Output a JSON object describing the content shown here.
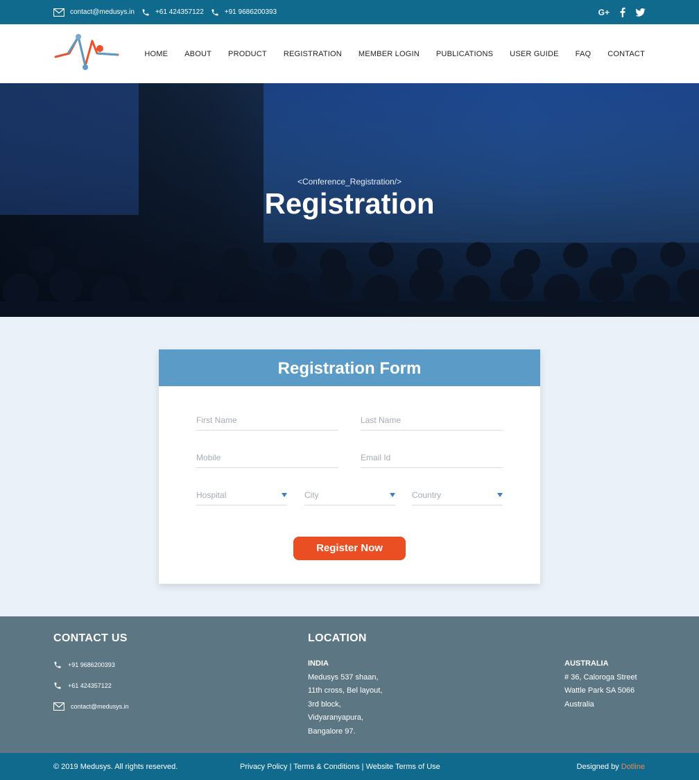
{
  "topbar": {
    "email": "contact@medusys.in",
    "phone1": "+61 424357122",
    "phone2": "+91 9686200393",
    "social": [
      "google-plus",
      "facebook",
      "twitter"
    ],
    "gplus_label": "G+"
  },
  "nav": {
    "items": [
      "HOME",
      "ABOUT",
      "PRODUCT",
      "REGISTRATION",
      "MEMBER LOGIN",
      "PUBLICATIONS",
      "USER GUIDE",
      "FAQ",
      "CONTACT"
    ]
  },
  "hero": {
    "subtitle": "<Conference_Registration/>",
    "title": "Registration"
  },
  "form": {
    "title": "Registration Form",
    "first_name_placeholder": "First Name",
    "last_name_placeholder": "Last Name",
    "mobile_placeholder": "Mobile",
    "email_placeholder": "Email Id",
    "hospital_label": "Hospital",
    "city_label": "City",
    "country_label": "Country",
    "submit_label": "Register Now"
  },
  "footer": {
    "contact_title": "CONTACT US",
    "contact_phone1": "+91 9686200393",
    "contact_phone2": "+61 424357122",
    "contact_email": "contact@medusys.in",
    "location_title": "LOCATION",
    "india": {
      "country": "INDIA",
      "lines": [
        "Medusys 537 shaan,",
        "11th cross, Bel layout,",
        "3rd block,",
        "Vidyaranyapura,",
        "Bangalore 97."
      ]
    },
    "australia": {
      "country": "AUSTRALIA",
      "lines": [
        "# 36, Caloroga Street",
        "Wattle Park SA 5066",
        "Australia"
      ]
    }
  },
  "bottombar": {
    "copyright": "© 2019 Medusys. All rights reserved.",
    "links": "Privacy Policy | Terms & Conditions | Website Terms of Use",
    "designed_by": "Designed by",
    "designer": "Dotline"
  },
  "colors": {
    "topbar": "#0f6a8e",
    "form_header": "#5b9bc8",
    "button": "#ea4e23",
    "footer": "#5c7783"
  }
}
